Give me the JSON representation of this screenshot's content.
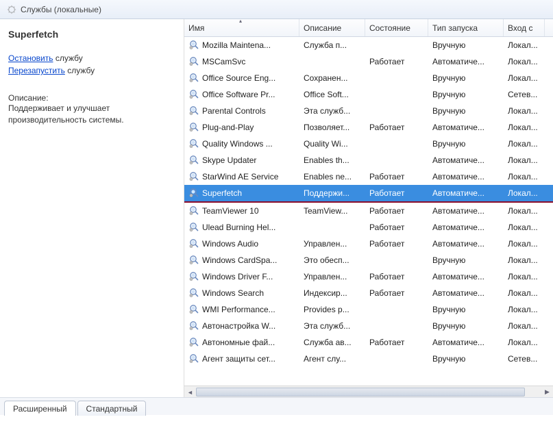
{
  "header": {
    "title": "Службы (локальные)"
  },
  "sidebar": {
    "service_name": "Superfetch",
    "stop_link": "Остановить",
    "stop_suffix": " службу",
    "restart_link": "Перезапустить",
    "restart_suffix": " службу",
    "desc_label": "Описание:",
    "desc_text": "Поддерживает и улучшает производительность системы."
  },
  "columns": {
    "name": "Имя",
    "desc": "Описание",
    "state": "Состояние",
    "start": "Тип запуска",
    "logon": "Вход с"
  },
  "services": [
    {
      "name": "Mozilla Maintena...",
      "desc": "Служба п...",
      "state": "",
      "start": "Вручную",
      "logon": "Локал..."
    },
    {
      "name": "MSCamSvc",
      "desc": "",
      "state": "Работает",
      "start": "Автоматиче...",
      "logon": "Локал..."
    },
    {
      "name": "Office  Source Eng...",
      "desc": "Сохранен...",
      "state": "",
      "start": "Вручную",
      "logon": "Локал..."
    },
    {
      "name": "Office Software Pr...",
      "desc": "Office Soft...",
      "state": "",
      "start": "Вручную",
      "logon": "Сетев..."
    },
    {
      "name": "Parental Controls",
      "desc": "Эта служб...",
      "state": "",
      "start": "Вручную",
      "logon": "Локал..."
    },
    {
      "name": "Plug-and-Play",
      "desc": "Позволяет...",
      "state": "Работает",
      "start": "Автоматиче...",
      "logon": "Локал..."
    },
    {
      "name": "Quality Windows ...",
      "desc": "Quality Wi...",
      "state": "",
      "start": "Вручную",
      "logon": "Локал..."
    },
    {
      "name": "Skype Updater",
      "desc": "Enables th...",
      "state": "",
      "start": "Автоматиче...",
      "logon": "Локал..."
    },
    {
      "name": "StarWind AE Service",
      "desc": "Enables ne...",
      "state": "Работает",
      "start": "Автоматиче...",
      "logon": "Локал..."
    },
    {
      "name": "Superfetch",
      "desc": "Поддержи...",
      "state": "Работает",
      "start": "Автоматиче...",
      "logon": "Локал...",
      "selected": true
    },
    {
      "name": "TeamViewer 10",
      "desc": "TeamView...",
      "state": "Работает",
      "start": "Автоматиче...",
      "logon": "Локал..."
    },
    {
      "name": "Ulead Burning Hel...",
      "desc": "",
      "state": "Работает",
      "start": "Автоматиче...",
      "logon": "Локал..."
    },
    {
      "name": "Windows Audio",
      "desc": "Управлен...",
      "state": "Работает",
      "start": "Автоматиче...",
      "logon": "Локал..."
    },
    {
      "name": "Windows CardSpa...",
      "desc": "Это обесп...",
      "state": "",
      "start": "Вручную",
      "logon": "Локал..."
    },
    {
      "name": "Windows Driver F...",
      "desc": "Управлен...",
      "state": "Работает",
      "start": "Автоматиче...",
      "logon": "Локал..."
    },
    {
      "name": "Windows Search",
      "desc": "Индексир...",
      "state": "Работает",
      "start": "Автоматиче...",
      "logon": "Локал..."
    },
    {
      "name": "WMI Performance...",
      "desc": "Provides p...",
      "state": "",
      "start": "Вручную",
      "logon": "Локал..."
    },
    {
      "name": "Автонастройка W...",
      "desc": "Эта служб...",
      "state": "",
      "start": "Вручную",
      "logon": "Локал..."
    },
    {
      "name": "Автономные фай...",
      "desc": "Служба ав...",
      "state": "Работает",
      "start": "Автоматиче...",
      "logon": "Локал..."
    },
    {
      "name": "Агент защиты сет...",
      "desc": "Агент слу...",
      "state": "",
      "start": "Вручную",
      "logon": "Сетев..."
    }
  ],
  "tabs": {
    "extended": "Расширенный",
    "standard": "Стандартный"
  }
}
